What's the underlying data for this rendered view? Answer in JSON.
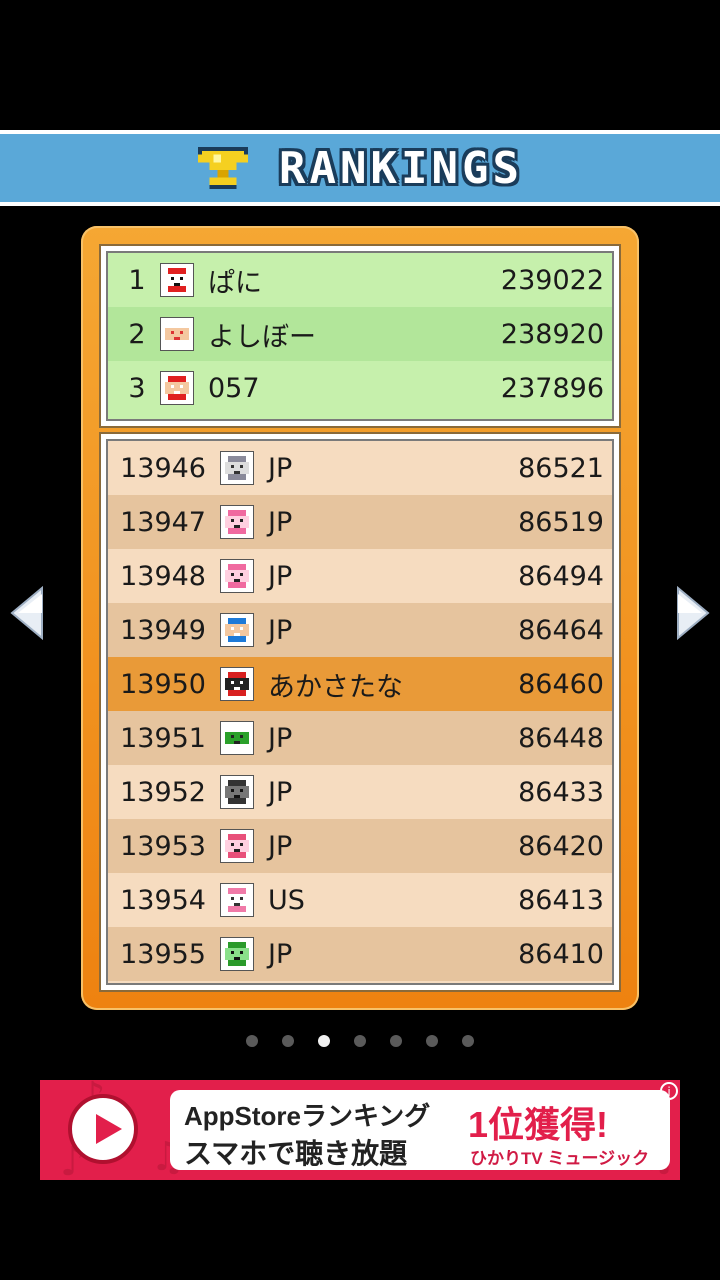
{
  "header": {
    "title": "RANKINGS",
    "icon": "trophy-icon"
  },
  "colors": {
    "header_bg": "#5aa8d8",
    "panel": "#f29a25",
    "top_bg": "#c6f0ac",
    "list_bg": "#f6dcc0",
    "highlight": "#e99a38",
    "ad_bg": "#e21f4b"
  },
  "top_rankings": [
    {
      "rank": "1",
      "name": "ぱに",
      "score": "239022",
      "avatar": "red-helmet-avatar"
    },
    {
      "rank": "2",
      "name": "よしぼー",
      "score": "238920",
      "avatar": "boy-avatar"
    },
    {
      "rank": "3",
      "name": "057",
      "score": "237896",
      "avatar": "red-hero-avatar"
    }
  ],
  "list_rankings": [
    {
      "rank": "13946",
      "name": "JP",
      "score": "86521",
      "avatar": "gray-cat-avatar"
    },
    {
      "rank": "13947",
      "name": "JP",
      "score": "86519",
      "avatar": "pink-cat-avatar"
    },
    {
      "rank": "13948",
      "name": "JP",
      "score": "86494",
      "avatar": "pink-cat-avatar"
    },
    {
      "rank": "13949",
      "name": "JP",
      "score": "86464",
      "avatar": "blue-cap-avatar"
    },
    {
      "rank": "13950",
      "name": "あかさたな",
      "score": "86460",
      "avatar": "red-mask-avatar",
      "highlighted": true
    },
    {
      "rank": "13951",
      "name": "JP",
      "score": "86448",
      "avatar": "skull-avatar"
    },
    {
      "rank": "13952",
      "name": "JP",
      "score": "86433",
      "avatar": "black-cat-avatar"
    },
    {
      "rank": "13953",
      "name": "JP",
      "score": "86420",
      "avatar": "pink-girl-avatar"
    },
    {
      "rank": "13954",
      "name": "US",
      "score": "86413",
      "avatar": "pink-robot-avatar"
    },
    {
      "rank": "13955",
      "name": "JP",
      "score": "86410",
      "avatar": "green-frog-avatar"
    }
  ],
  "navigation": {
    "prev": "left-arrow-icon",
    "next": "right-arrow-icon"
  },
  "pager": {
    "count": 7,
    "active_index": 2
  },
  "ad": {
    "line1": "AppStoreランキング",
    "line2": "スマホで聴き放題",
    "badge": "1位獲得!",
    "brand": "ひかりTV ミュージック",
    "info": "i"
  }
}
